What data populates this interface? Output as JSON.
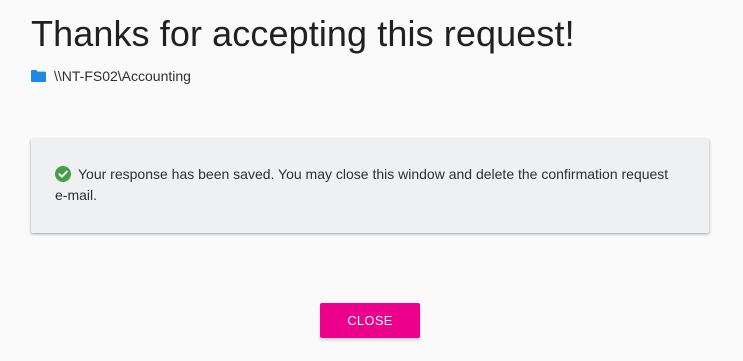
{
  "header": {
    "title": "Thanks for accepting this request!",
    "share_path": "\\\\NT-FS02\\Accounting",
    "folder_icon": "folder-icon",
    "folder_icon_color": "#1e88e5"
  },
  "alert": {
    "message": "Your response has been saved. You may close this window and delete the confirmation request e-mail.",
    "icon": "check-circle-icon",
    "icon_color": "#43a047",
    "background": "#eef0f2"
  },
  "actions": {
    "close_label": "CLOSE",
    "close_color": "#ec008c"
  }
}
